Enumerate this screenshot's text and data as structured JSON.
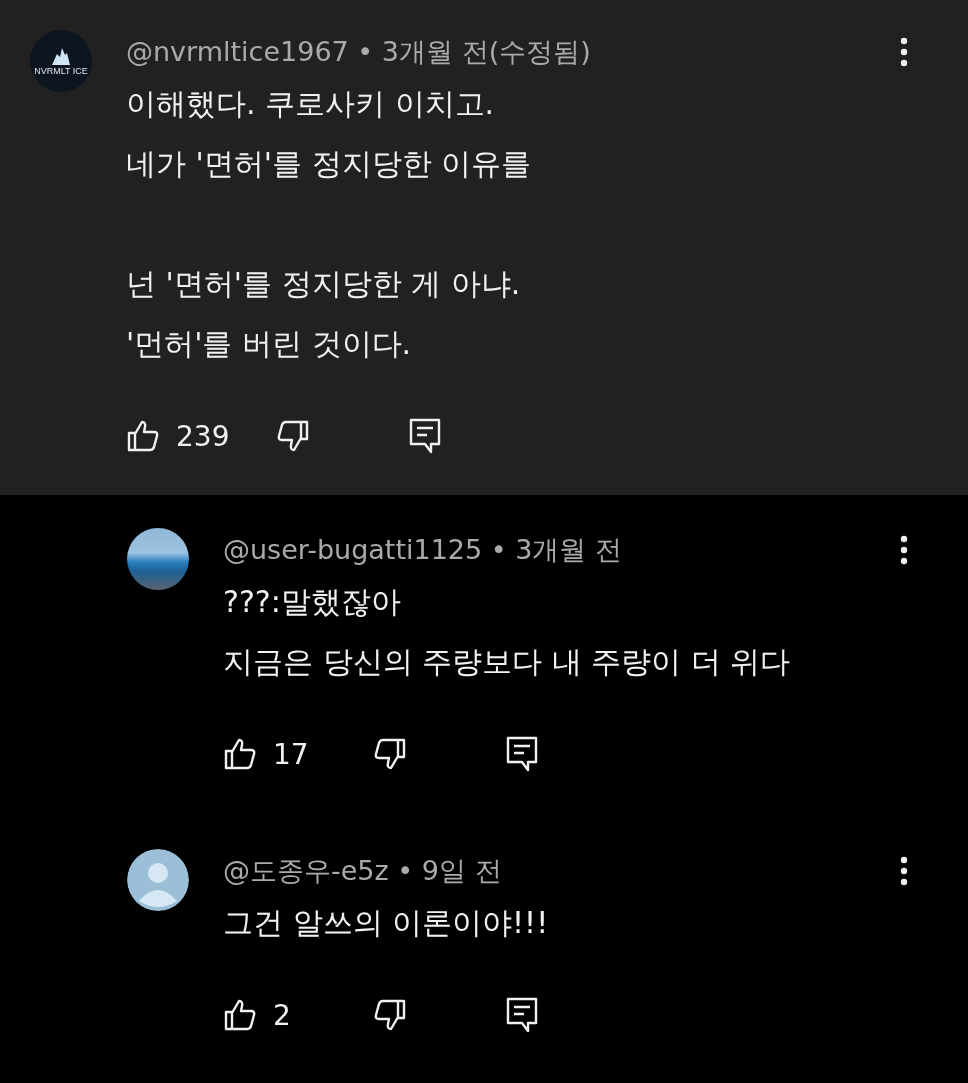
{
  "comments": [
    {
      "kind": "top",
      "avatar": {
        "kind": "logo",
        "text": "NVRMLT ICE"
      },
      "meta": "@nvrmltice1967 • 3개월 전(수정됨)",
      "paragraphs": [
        [
          "이해했다. 쿠로사키 이치고.",
          "네가 '면허'를 정지당한 이유를"
        ],
        [
          "넌 '면허'를 정지당한 게 아냐.",
          "'먼허'를 버린 것이다."
        ]
      ],
      "likes": "239"
    },
    {
      "kind": "reply",
      "avatar": {
        "kind": "photo"
      },
      "meta": "@user-bugatti1125 • 3개월 전",
      "paragraphs": [
        [
          "???:말했잖아",
          "지금은 당신의 주량보다 내 주량이 더 위다"
        ]
      ],
      "likes": "17"
    },
    {
      "kind": "reply",
      "avatar": {
        "kind": "default"
      },
      "meta": "@도종우-e5z • 9일 전",
      "paragraphs": [
        [
          "그건 알쓰의 이론이야!!!"
        ]
      ],
      "likes": "2"
    }
  ]
}
